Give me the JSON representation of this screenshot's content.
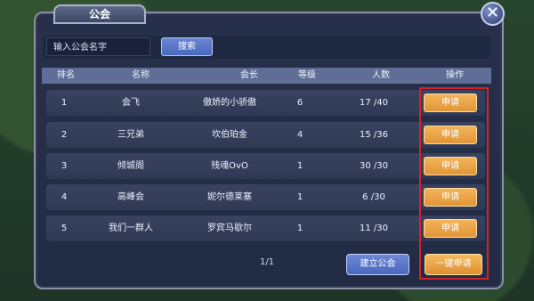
{
  "window": {
    "title": "公会",
    "close_symbol": "✕"
  },
  "search": {
    "input_value": "输入公会名字",
    "button_label": "搜索"
  },
  "table": {
    "headers": [
      "排名",
      "名称",
      "会长",
      "等级",
      "人数",
      "操作"
    ],
    "rows": [
      {
        "rank": "1",
        "name": "会飞",
        "leader": "傲娇的小骄傲",
        "level": "6",
        "members": "17 /40",
        "action_label": "申请"
      },
      {
        "rank": "2",
        "name": "三兄弟",
        "leader": "坎伯珀金",
        "level": "4",
        "members": "15 /36",
        "action_label": "申请"
      },
      {
        "rank": "3",
        "name": "倾城阁",
        "leader": "残魂OvO",
        "level": "1",
        "members": "30 /30",
        "action_label": "申请"
      },
      {
        "rank": "4",
        "name": "高峰会",
        "leader": "妮尔德莱塞",
        "level": "1",
        "members": "6 /30",
        "action_label": "申请"
      },
      {
        "rank": "5",
        "name": "我们一群人",
        "leader": "罗宾马歇尔",
        "level": "1",
        "members": "11 /30",
        "action_label": "申请"
      }
    ]
  },
  "footer": {
    "page_indicator": "1/1",
    "create_button": "建立公会",
    "one_key_apply_button": "一键申请"
  },
  "icons": {
    "close": "close-icon"
  },
  "colors": {
    "apply_button": "#e9a247",
    "blue_button": "#5878cc",
    "highlight_frame": "#d6222a"
  }
}
